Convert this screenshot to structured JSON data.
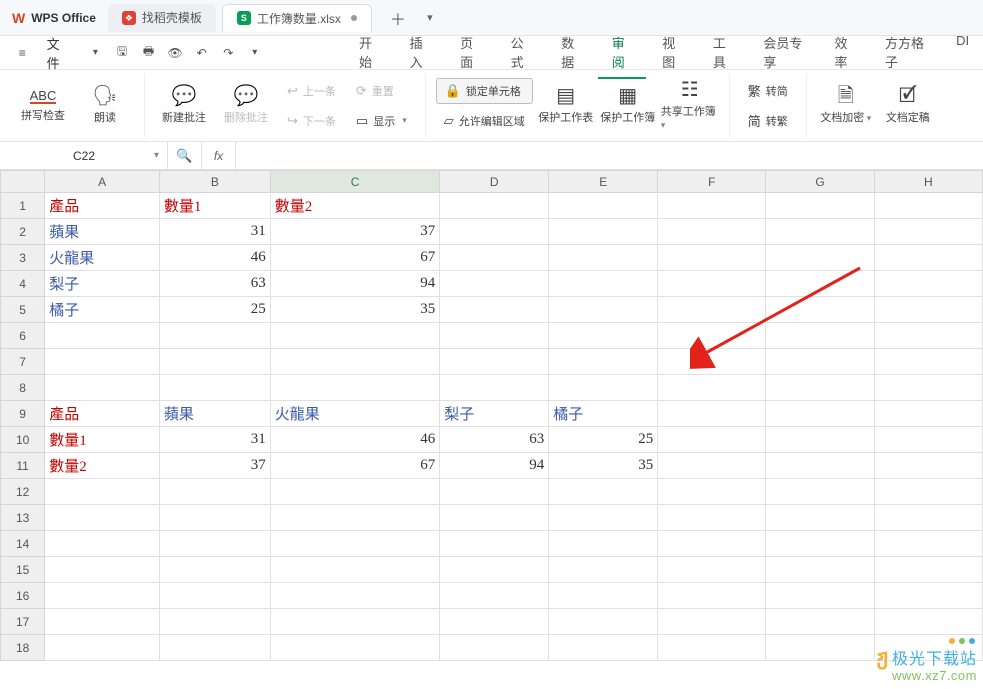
{
  "app": {
    "brand": "WPS Office"
  },
  "tabs": [
    {
      "label": "找稻壳模板",
      "active": false
    },
    {
      "label": "工作簿数量.xlsx",
      "active": true,
      "modified": true
    }
  ],
  "fileMenu": "文件",
  "menu": {
    "items": [
      "开始",
      "插入",
      "页面",
      "公式",
      "数据",
      "审阅",
      "视图",
      "工具",
      "会员专享",
      "效率",
      "方方格子",
      "DI"
    ],
    "activeIndex": 5
  },
  "ribbon": {
    "spellcheck": "拼写检查",
    "read": "朗读",
    "newComment": "新建批注",
    "delComment": "删除批注",
    "prevComment": "上一条",
    "nextComment": "下一条",
    "resetComment": "重置",
    "display": "显示",
    "lockCell": "锁定单元格",
    "allowEdit": "允许编辑区域",
    "protectSheet": "保护工作表",
    "protectBook": "保护工作簿",
    "shareBook": "共享工作簿",
    "simpTrad1": "转简",
    "simpTrad2": "转繁",
    "simpLabel1": "繁",
    "simpLabel2": "简",
    "encrypt": "文档加密",
    "finalize": "文档定稿"
  },
  "abcGlyph": "ABC",
  "namebox": "C22",
  "fx": "fx",
  "columns": [
    "A",
    "B",
    "C",
    "D",
    "E",
    "F",
    "G",
    "H"
  ],
  "rowCount": 16,
  "selected": {
    "col": 2,
    "row": 21
  },
  "chart_data": [
    {
      "type": "table",
      "title_col": "產品",
      "categories": [
        "蘋果",
        "火龍果",
        "梨子",
        "橘子"
      ],
      "series": [
        {
          "name": "數量1",
          "values": [
            31,
            46,
            63,
            25
          ]
        },
        {
          "name": "數量2",
          "values": [
            37,
            67,
            94,
            35
          ]
        }
      ]
    }
  ],
  "cells": {
    "A1": "產品",
    "B1": "數量1",
    "C1": "數量2",
    "A2": "蘋果",
    "B2": "31",
    "C2": "37",
    "A3": "火龍果",
    "B3": "46",
    "C3": "67",
    "A4": "梨子",
    "B4": "63",
    "C4": "94",
    "A5": "橘子",
    "B5": "25",
    "C5": "35",
    "A9": "產品",
    "B9": "蘋果",
    "C9": "火龍果",
    "D9": "梨子",
    "E9": "橘子",
    "A10": "數量1",
    "B10": "31",
    "C10": "46",
    "D10": "63",
    "E10": "25",
    "A11": "數量2",
    "B11": "37",
    "C11": "67",
    "D11": "94",
    "E11": "35"
  },
  "watermark": {
    "name": "极光下载站",
    "url": "www.xz7.com"
  }
}
